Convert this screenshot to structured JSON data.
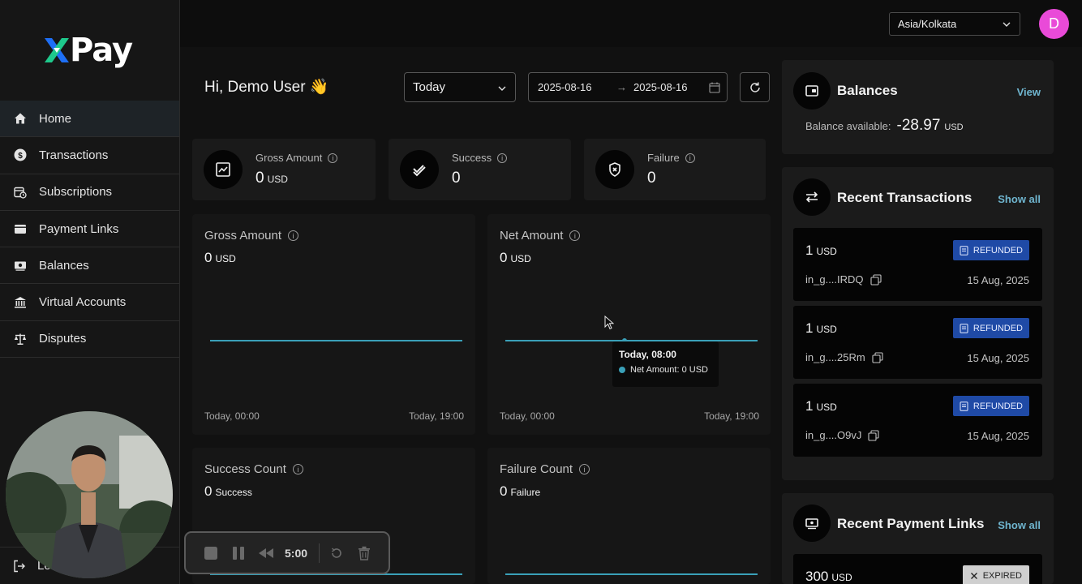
{
  "brand": {
    "name": "Pay",
    "accent": "#1e6ff5"
  },
  "sidebar": {
    "items": [
      {
        "label": "Home",
        "icon": "home-icon"
      },
      {
        "label": "Transactions",
        "icon": "dollar-circle-icon"
      },
      {
        "label": "Subscriptions",
        "icon": "calendar-clock-icon"
      },
      {
        "label": "Payment Links",
        "icon": "wallet-icon"
      },
      {
        "label": "Balances",
        "icon": "cash-icon"
      },
      {
        "label": "Virtual Accounts",
        "icon": "bank-icon"
      },
      {
        "label": "Disputes",
        "icon": "scales-icon"
      }
    ],
    "logout_label": "Lo"
  },
  "topbar": {
    "timezone": "Asia/Kolkata",
    "avatar_initial": "D"
  },
  "main": {
    "greeting": "Hi, Demo User 👋",
    "range": "Today",
    "date_from": "2025-08-16",
    "date_arrow": "→",
    "date_to": "2025-08-16"
  },
  "stats": [
    {
      "title": "Gross Amount",
      "value": "0",
      "unit": "USD"
    },
    {
      "title": "Success",
      "value": "0",
      "unit": ""
    },
    {
      "title": "Failure",
      "value": "0",
      "unit": ""
    }
  ],
  "charts": [
    {
      "title": "Gross Amount",
      "value": "0",
      "unit": "USD",
      "x_start": "Today, 00:00",
      "x_end": "Today, 19:00"
    },
    {
      "title": "Net Amount",
      "value": "0",
      "unit": "USD",
      "x_start": "Today, 00:00",
      "x_end": "Today, 19:00"
    },
    {
      "title": "Success Count",
      "value": "0",
      "unit": "Success"
    },
    {
      "title": "Failure Count",
      "value": "0",
      "unit": "Failure"
    }
  ],
  "tooltip": {
    "time": "Today, 08:00",
    "label": "Net Amount: 0 USD"
  },
  "balances": {
    "title": "Balances",
    "link": "View",
    "available_label": "Balance available:",
    "amount": "-28.97",
    "unit": "USD"
  },
  "recent_transactions": {
    "title": "Recent Transactions",
    "link": "Show all",
    "items": [
      {
        "amount": "1",
        "unit": "USD",
        "status": "REFUNDED",
        "id": "in_g....IRDQ",
        "date": "15 Aug, 2025"
      },
      {
        "amount": "1",
        "unit": "USD",
        "status": "REFUNDED",
        "id": "in_g....25Rm",
        "date": "15 Aug, 2025"
      },
      {
        "amount": "1",
        "unit": "USD",
        "status": "REFUNDED",
        "id": "in_g....O9vJ",
        "date": "15 Aug, 2025"
      }
    ]
  },
  "recent_payment_links": {
    "title": "Recent Payment Links",
    "link": "Show all",
    "items": [
      {
        "amount": "300",
        "unit": "USD",
        "status": "EXPIRED"
      }
    ]
  },
  "recorder": {
    "time": "5:00"
  }
}
